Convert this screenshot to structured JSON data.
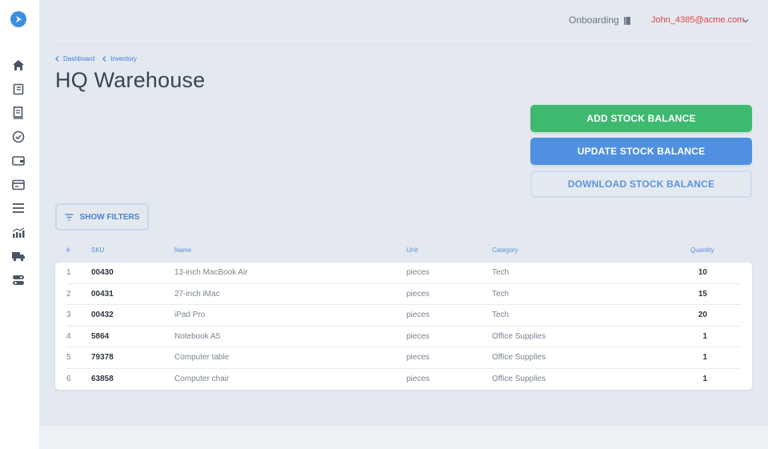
{
  "header": {
    "onboarding_label": "Onboarding",
    "user_email": "John_4385@acme.com"
  },
  "breadcrumb": [
    {
      "label": "Dashboard"
    },
    {
      "label": "Inventory"
    }
  ],
  "page": {
    "title": "HQ Warehouse"
  },
  "actions": {
    "add_label": "ADD STOCK BALANCE",
    "update_label": "UPDATE STOCK BALANCE",
    "download_label": "DOWNLOAD STOCK BALANCE",
    "filters_label": "SHOW FILTERS"
  },
  "colors": {
    "add": "#3dba6f",
    "update": "#4f90e0",
    "accent": "#3b7ed8",
    "user": "#e0454b"
  },
  "sidebar": {
    "items": [
      {
        "icon": "home-icon"
      },
      {
        "icon": "receipt-icon"
      },
      {
        "icon": "document-icon"
      },
      {
        "icon": "check-circle-icon"
      },
      {
        "icon": "wallet-icon"
      },
      {
        "icon": "card-icon"
      },
      {
        "icon": "menu-icon"
      },
      {
        "icon": "chart-icon"
      },
      {
        "icon": "truck-icon"
      },
      {
        "icon": "toggle-icon"
      }
    ]
  },
  "table": {
    "columns": [
      "#",
      "SKU",
      "Name",
      "Unit",
      "Category",
      "Quantity"
    ],
    "rows": [
      {
        "num": "1",
        "sku": "00430",
        "name": "13-inch MacBook Air",
        "unit": "pieces",
        "category": "Tech",
        "qty": "10"
      },
      {
        "num": "2",
        "sku": "00431",
        "name": "27-inch iMac",
        "unit": "pieces",
        "category": "Tech",
        "qty": "15"
      },
      {
        "num": "3",
        "sku": "00432",
        "name": "iPad Pro",
        "unit": "pieces",
        "category": "Tech",
        "qty": "20"
      },
      {
        "num": "4",
        "sku": "5864",
        "name": "Notebook A5",
        "unit": "pieces",
        "category": "Office Supplies",
        "qty": "1"
      },
      {
        "num": "5",
        "sku": "79378",
        "name": "Computer table",
        "unit": "pieces",
        "category": "Office Supplies",
        "qty": "1"
      },
      {
        "num": "6",
        "sku": "63858",
        "name": "Computer chair",
        "unit": "pieces",
        "category": "Office Supplies",
        "qty": "1"
      }
    ]
  }
}
